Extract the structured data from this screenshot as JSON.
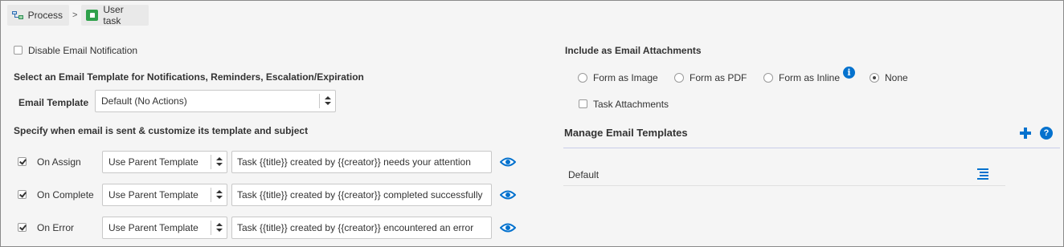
{
  "breadcrumb": {
    "items": [
      {
        "label": "Process",
        "icon": "process-icon"
      },
      {
        "label": "User task",
        "icon": "user-task-icon"
      }
    ],
    "separator": ">"
  },
  "notifications": {
    "disable_label": "Disable Email Notification",
    "disable_checked": false,
    "template_section_heading": "Select an Email Template for Notifications, Reminders, Escalation/Expiration",
    "email_template_label": "Email Template",
    "email_template_value": "Default (No Actions)",
    "when_heading": "Specify when email is sent & customize its template and subject",
    "rows": [
      {
        "label": "On Assign",
        "checked": true,
        "template": "Use Parent Template",
        "subject": "Task {{title}} created by {{creator}} needs your attention"
      },
      {
        "label": "On Complete",
        "checked": true,
        "template": "Use Parent Template",
        "subject": "Task {{title}} created by {{creator}} completed successfully"
      },
      {
        "label": "On Error",
        "checked": true,
        "template": "Use Parent Template",
        "subject": "Task {{title}} created by {{creator}} encountered an error"
      }
    ]
  },
  "attachments": {
    "heading": "Include as Email Attachments",
    "options": [
      {
        "label": "Form as Image",
        "selected": false
      },
      {
        "label": "Form as PDF",
        "selected": false
      },
      {
        "label": "Form as Inline",
        "selected": false
      },
      {
        "label": "None",
        "selected": true
      }
    ],
    "info_glyph": "i",
    "task_attachments_label": "Task Attachments",
    "task_attachments_checked": false
  },
  "manage": {
    "heading": "Manage Email Templates",
    "help_glyph": "?",
    "templates": [
      {
        "name": "Default"
      }
    ]
  },
  "colors": {
    "accent": "#0572ce",
    "background": "#f5f5f5",
    "usertask_green": "#2ea04a"
  }
}
